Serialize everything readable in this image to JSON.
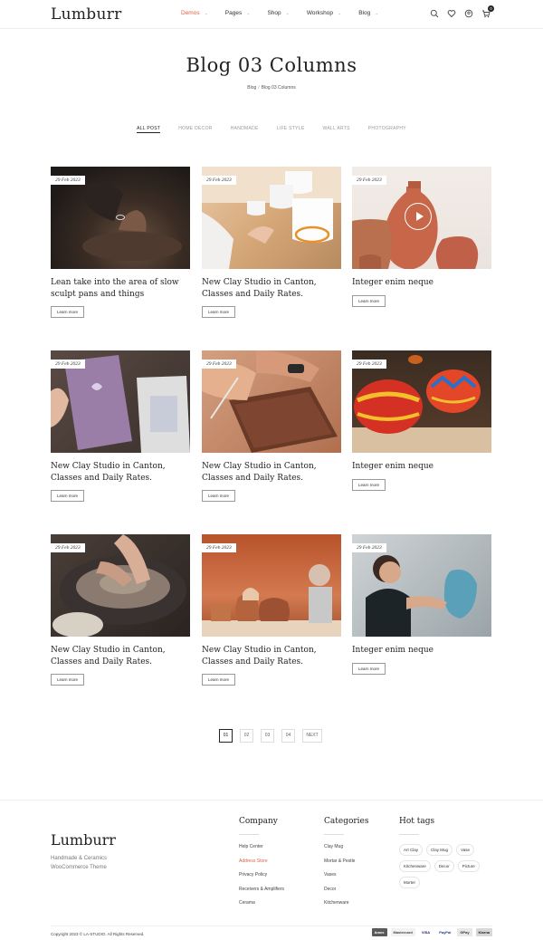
{
  "header": {
    "logo": "Lumburr",
    "nav": [
      {
        "label": "Demos",
        "active": true
      },
      {
        "label": "Pages",
        "active": false
      },
      {
        "label": "Shop",
        "active": false
      },
      {
        "label": "Workshop",
        "active": false
      },
      {
        "label": "Blog",
        "active": false
      }
    ],
    "icons": [
      "search-icon",
      "heart-icon",
      "user-icon",
      "cart-icon"
    ],
    "cart_count": "0"
  },
  "page": {
    "title": "Blog 03 Columns",
    "breadcrumb": {
      "parent": "Blog",
      "separator": "/",
      "current": "Blog 03 Columns"
    }
  },
  "filters": [
    "ALL POST",
    "HOME DECOR",
    "HANDMADE",
    "LIFE STYLE",
    "WALL ARTS",
    "PHOTOGRAPHY"
  ],
  "posts": [
    {
      "date": "29 Feb 2023",
      "title": "Lean take into the area of slow sculpt pans and things",
      "cta": "Learn more"
    },
    {
      "date": "29 Feb 2023",
      "title": "New Clay Studio in Canton, Classes and Daily Rates.",
      "cta": "Learn more"
    },
    {
      "date": "29 Feb 2023",
      "title": "Integer enim neque",
      "cta": "Learn more"
    },
    {
      "date": "29 Feb 2023",
      "title": "New Clay Studio in Canton, Classes and Daily Rates.",
      "cta": "Learn more"
    },
    {
      "date": "29 Feb 2023",
      "title": "New Clay Studio in Canton, Classes and Daily Rates.",
      "cta": "Learn more"
    },
    {
      "date": "29 Feb 2023",
      "title": "Integer enim neque",
      "cta": "Learn more"
    },
    {
      "date": "29 Feb 2023",
      "title": "New Clay Studio in Canton, Classes and Daily Rates.",
      "cta": "Learn more"
    },
    {
      "date": "29 Feb 2023",
      "title": "New Clay Studio in Canton, Classes and Daily Rates.",
      "cta": "Learn more"
    },
    {
      "date": "29 Feb 2023",
      "title": "Integer enim neque",
      "cta": "Learn more"
    }
  ],
  "pagination": {
    "pages": [
      "01",
      "02",
      "03",
      "04"
    ],
    "next": "NEXT",
    "current": "01"
  },
  "footer": {
    "logo": "Lumburr",
    "tagline": "Handmade & Ceramics WooCommerce Theme",
    "company": {
      "heading": "Company",
      "links": [
        "Help Center",
        "Address Store",
        "Privacy Policy",
        "Receivers & Amplifiers",
        "Cerama"
      ]
    },
    "categories": {
      "heading": "Categories",
      "links": [
        "Clay Mug",
        "Mortar & Pestle",
        "Vases",
        "Decor",
        "Kitchenware"
      ]
    },
    "hot_tags": {
      "heading": "Hot tags",
      "tags": [
        "Art Clay",
        "Clay Mug",
        "Vase",
        "Kitchenware",
        "Decor",
        "Picture",
        "Morter"
      ]
    },
    "copyright": "Copyright 2023 © LA-STUDIO. All Rights Reserved.",
    "payments": [
      "Amex",
      "Mastercard",
      "VISA",
      "PayPal",
      "GPay",
      "Klarna"
    ]
  },
  "colors": {
    "accent": "#e0604a",
    "text": "#222222"
  }
}
